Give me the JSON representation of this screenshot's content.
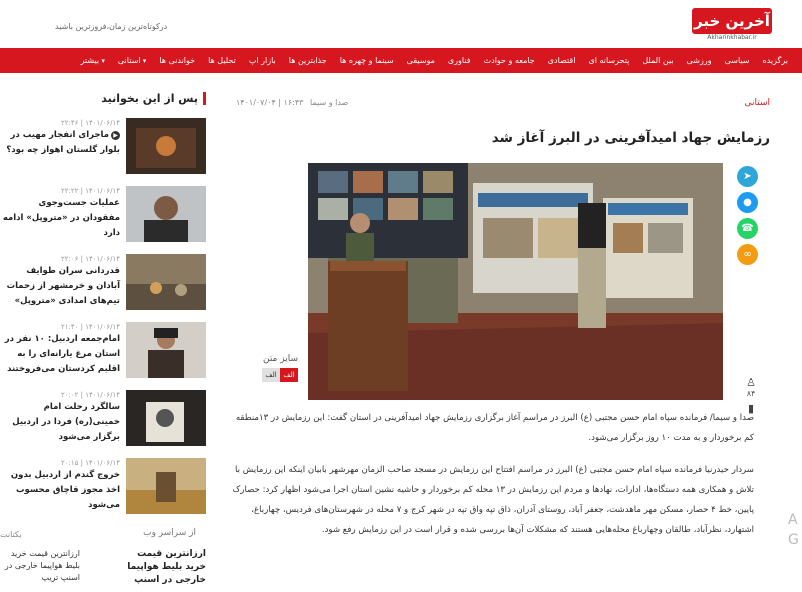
{
  "site": {
    "logo_text": "آخرین خبر",
    "logo_sub": "Akharinkhabar.ir",
    "tagline": "درکوتاه‌ترین زمان،فروزترین باشید"
  },
  "nav": [
    "برگزیده",
    "سیاسی",
    "ورزشی",
    "بین الملل",
    "پتحرسانه ای",
    "اقتصادی",
    "جامعه و حوادث",
    "فناوری",
    "موسیقی",
    "سینما و چهره ها",
    "جذابترین ها",
    "بازار اپ",
    "تحلیل ها",
    "خواندنی ها",
    "استانی",
    "بیشتر"
  ],
  "nav_dropdowns": [
    14,
    15
  ],
  "colors": {
    "accent": "#d6171f"
  },
  "article": {
    "category": "استانی",
    "service": "صدا و سیما",
    "date": "۱۴۰۱/۰۷/۰۴ | ۱۶:۴۳",
    "title": "رزمایش جهاد امیدآفرینی در البرز آغاز شد",
    "font_size_label": "سایز متن",
    "font_buttons": [
      "الف",
      "الف"
    ],
    "views": "۸۴",
    "paragraphs": [
      "صدا و سیما/ فرمانده سپاه امام حسن مجتبی (ع) البرز در مراسم آغاز برگزاری رزمایش جهاد امیدآفرینی در استان گفت: این رزمایش در ۱۳منطقه کم برخوردار و به مدت ۱۰ روز برگزار می‌شود.",
      "سردار حیدرنیا فرمانده سپاه امام حسن مجتبی (ع) البرز در مراسم افتتاح این رزمایش در مسجد صاحب الزمان مهرشهر بابیان اینکه این رزمایش با تلاش و همکاری همه دستگاه‌ها، ادارات، نهادها و مردم این رزمایش در ۱۳ محله کم برخوردار و حاشیه نشین استان اجرا می‌شود اظهار کرد: حصارک پایین، خط ۴ حصار، مسکن مهر ماهدشت، جعفر آباد، روستای آدران، ذاق تپه واق تپه در شهر کرج و ۷ محله در شهرستان‌های فردیس، چهارباغ، اشتهارد، نظرآباد، طالقان وچهارباغ محله‌هایی هستند که مشکلات آن‌ها بررسی شده و قرار است در این رزمایش رفع شود."
    ],
    "share_icons": [
      "telegram-icon",
      "twitter-icon",
      "whatsapp-icon",
      "link-icon"
    ]
  },
  "sidebar": {
    "heading": "پس از این بخوانید",
    "items": [
      {
        "time": "۱۴۰۱/۰۶/۱۴ | ۲۲:۴۶",
        "title": "ماجرای انفجار مهیب در بلوار گلستان اهواز چه بود؟",
        "video": true
      },
      {
        "time": "۱۴۰۱/۰۶/۱۴ | ۲۲:۲۲",
        "title": "عملیات جست‌وجوی مفقودان در «متروپل» ادامه دارد",
        "video": false
      },
      {
        "time": "۱۴۰۱/۰۶/۱۴ | ۲۲:۰۶",
        "title": "قدردانی سران طوایف آبادان و خرمشهر از زحمات تیم‌های امدادی «متروپل»",
        "video": false
      },
      {
        "time": "۱۴۰۱/۰۶/۱۴ | ۲۱:۴۰",
        "title": "امام‌جمعه اردبیل: ۱۰ نفر در استان مرغ یارانه‌ای را به اقلیم کردستان می‌فروختند",
        "video": false
      },
      {
        "time": "۱۴۰۱/۰۶/۱۴ | ۲۰:۰۲",
        "title": "سالگرد رحلت امام خمینی(ره) فردا در اردبیل برگزار می‌شود",
        "video": false
      },
      {
        "time": "۱۴۰۱/۰۶/۱۴ | ۲۰:۱۵",
        "title": "خروج گندم از اردبیل بدون اخذ مجوز قاچاق محسوب می‌شود",
        "video": false
      }
    ],
    "section2": "از سراسر وب",
    "section2_logo": "یکتانت",
    "web_items": [
      "ارزانترین قیمت خرید بلیط هواپیما خارجی در اسنپ تریپ",
      "ارزانترین قیمت خرید بلیط هواپیما خارجی در اسنپ"
    ]
  }
}
